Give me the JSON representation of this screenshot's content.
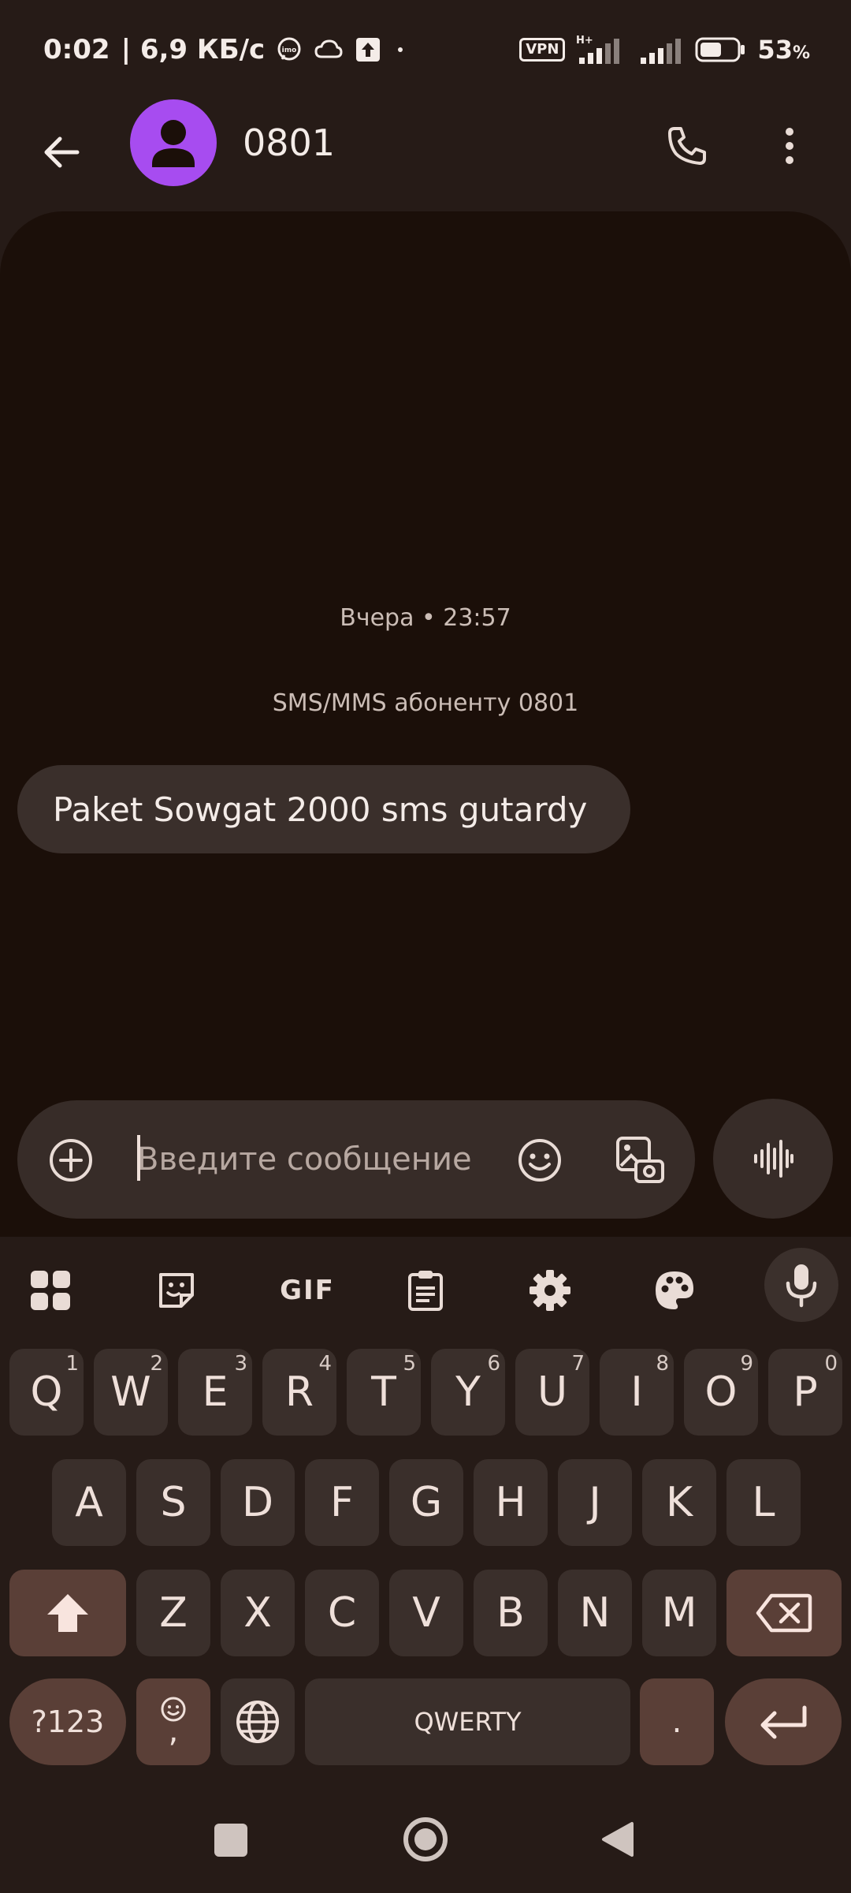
{
  "status_bar": {
    "time": "0:02",
    "speed": "| 6,9 КБ/с",
    "imo_label": "imo",
    "vpn_label": "VPN",
    "network_label": "H+",
    "battery": "53",
    "battery_unit": "%"
  },
  "header": {
    "title": "0801"
  },
  "conversation": {
    "date": "Вчера • 23:57",
    "sms_label": "SMS/MMS абоненту 0801",
    "message": "Paket Sowgat 2000 sms gutardy"
  },
  "compose": {
    "placeholder": "Введите сообщение"
  },
  "keyboard": {
    "toolbar": {
      "gif_label": "GIF"
    },
    "rows": {
      "row1": [
        {
          "label": "Q",
          "hint": "1"
        },
        {
          "label": "W",
          "hint": "2"
        },
        {
          "label": "E",
          "hint": "3"
        },
        {
          "label": "R",
          "hint": "4"
        },
        {
          "label": "T",
          "hint": "5"
        },
        {
          "label": "Y",
          "hint": "6"
        },
        {
          "label": "U",
          "hint": "7"
        },
        {
          "label": "I",
          "hint": "8"
        },
        {
          "label": "O",
          "hint": "9"
        },
        {
          "label": "P",
          "hint": "0"
        }
      ],
      "row2": [
        "A",
        "S",
        "D",
        "F",
        "G",
        "H",
        "J",
        "K",
        "L"
      ],
      "row3": [
        "Z",
        "X",
        "C",
        "V",
        "B",
        "N",
        "M"
      ]
    },
    "symbols_label": "?123",
    "comma_label": ",",
    "space_label": "QWERTY",
    "period_label": "."
  },
  "colors": {
    "accent_avatar": "#a74cf0",
    "background": "#261b17",
    "conversation_bg": "#1b0f09",
    "bubble": "#3a2f2b",
    "function_key": "#5a3f37"
  }
}
